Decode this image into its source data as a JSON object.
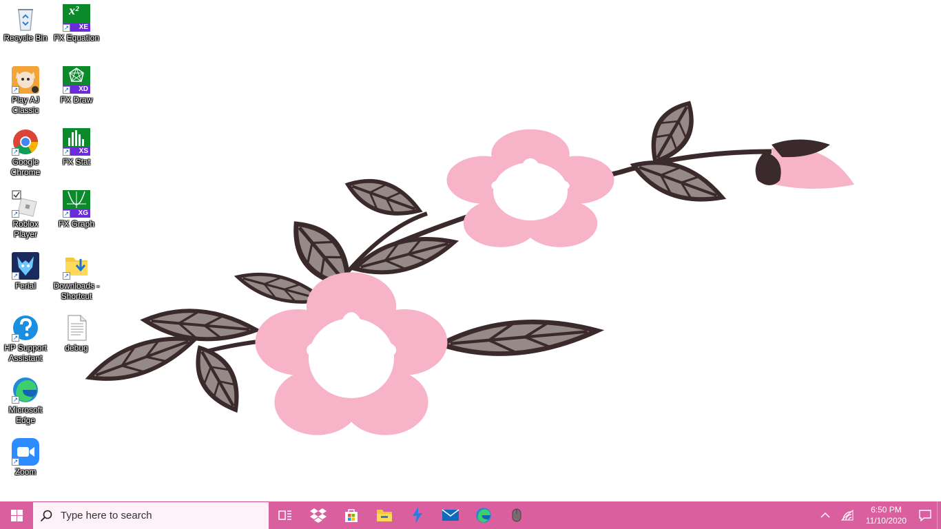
{
  "desktop": {
    "icons": [
      {
        "id": "recycle-bin",
        "label": "Recycle Bin",
        "icon": "recycle-bin-icon"
      },
      {
        "id": "fx-equation",
        "label": "FX Equation",
        "icon": "fx-equation-icon",
        "badge": "XE"
      },
      {
        "id": "play-aj-classic",
        "label": "Play AJ Classic",
        "icon": "animal-jam-icon"
      },
      {
        "id": "fx-draw",
        "label": "FX Draw",
        "icon": "fx-draw-icon",
        "badge": "XD"
      },
      {
        "id": "google-chrome",
        "label": "Google Chrome",
        "icon": "chrome-icon"
      },
      {
        "id": "fx-stat",
        "label": "FX Stat",
        "icon": "fx-stat-icon",
        "badge": "XS"
      },
      {
        "id": "roblox-player",
        "label": "Roblox Player",
        "icon": "roblox-icon"
      },
      {
        "id": "fx-graph",
        "label": "FX Graph",
        "icon": "fx-graph-icon",
        "badge": "XG"
      },
      {
        "id": "ferial",
        "label": "Ferial",
        "icon": "ferial-icon"
      },
      {
        "id": "downloads-shortcut",
        "label": "Downloads - Shortcut",
        "icon": "folder-download-icon"
      },
      {
        "id": "hp-support-assistant",
        "label": "HP Support Assistant",
        "icon": "help-icon"
      },
      {
        "id": "debug",
        "label": "debug",
        "icon": "text-file-icon"
      },
      {
        "id": "microsoft-edge",
        "label": "Microsoft Edge",
        "icon": "edge-icon"
      },
      {
        "id": "zoom",
        "label": "Zoom",
        "icon": "zoom-icon"
      }
    ]
  },
  "taskbar": {
    "search_placeholder": "Type here to search",
    "pinned": [
      "task-view-icon",
      "dropbox-icon",
      "store-icon",
      "file-explorer-icon",
      "power-automate-icon",
      "mail-icon",
      "edge-icon",
      "mouse-icon"
    ],
    "clock": {
      "time": "6:50 PM",
      "date": "11/10/2020"
    }
  },
  "colors": {
    "taskbar": "#d95f9f",
    "search_bg": "#fff1f8",
    "petal": "#f7b3c8",
    "leaf": "#958a88",
    "leaf_outline": "#3b2a2b"
  }
}
